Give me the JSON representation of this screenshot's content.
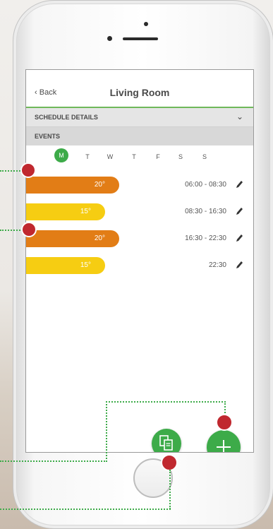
{
  "app": {
    "back_label": "Back",
    "title": "Living Room"
  },
  "schedule_section": {
    "label": "SCHEDULE DETAILS"
  },
  "events_section": {
    "label": "EVENTS"
  },
  "days": [
    "M",
    "T",
    "W",
    "T",
    "F",
    "S",
    "S"
  ],
  "selected_day": "M",
  "events": [
    {
      "temp": "20°",
      "time": "06:00 - 08:30",
      "color": "#e27d16"
    },
    {
      "temp": "15°",
      "time": "08:30 - 16:30",
      "color": "#f6cd12"
    },
    {
      "temp": "20°",
      "time": "16:30 - 22:30",
      "color": "#e27d16"
    },
    {
      "temp": "15°",
      "time": "22:30",
      "color": "#f6cd12"
    }
  ],
  "colors": {
    "accent": "#3dab49",
    "callout": "#c0282f",
    "warm": "#e27d16",
    "cool": "#f6cd12"
  }
}
